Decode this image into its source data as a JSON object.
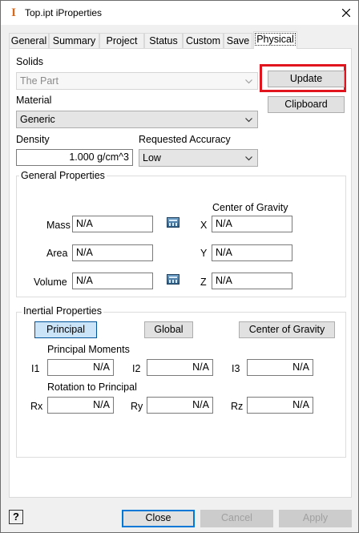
{
  "window": {
    "title": "Top.ipt iProperties"
  },
  "tabs": [
    "General",
    "Summary",
    "Project",
    "Status",
    "Custom",
    "Save",
    "Physical"
  ],
  "physical": {
    "solids_label": "Solids",
    "solids_value": "The Part",
    "update_label": "Update",
    "clipboard_label": "Clipboard",
    "material_label": "Material",
    "material_value": "Generic",
    "density_label": "Density",
    "density_value": "1.000 g/cm^3",
    "accuracy_label": "Requested Accuracy",
    "accuracy_value": "Low",
    "general_properties": {
      "title": "General Properties",
      "mass_label": "Mass",
      "mass_value": "N/A",
      "area_label": "Area",
      "area_value": "N/A",
      "volume_label": "Volume",
      "volume_value": "N/A",
      "cog_title": "Center of Gravity",
      "x_label": "X",
      "x_value": "N/A",
      "y_label": "Y",
      "y_value": "N/A",
      "z_label": "Z",
      "z_value": "N/A"
    },
    "inertial_properties": {
      "title": "Inertial Properties",
      "principal_label": "Principal",
      "global_label": "Global",
      "cog_label": "Center of Gravity",
      "moments_title": "Principal Moments",
      "i1_label": "I1",
      "i1_value": "N/A",
      "i2_label": "I2",
      "i2_value": "N/A",
      "i3_label": "I3",
      "i3_value": "N/A",
      "rotation_title": "Rotation to Principal",
      "rx_label": "Rx",
      "rx_value": "N/A",
      "ry_label": "Ry",
      "ry_value": "N/A",
      "rz_label": "Rz",
      "rz_value": "N/A"
    }
  },
  "footer": {
    "help": "?",
    "close_label": "Close",
    "cancel_label": "Cancel",
    "apply_label": "Apply"
  },
  "colors": {
    "highlight": "#e0151e",
    "accent": "#0078d7"
  }
}
